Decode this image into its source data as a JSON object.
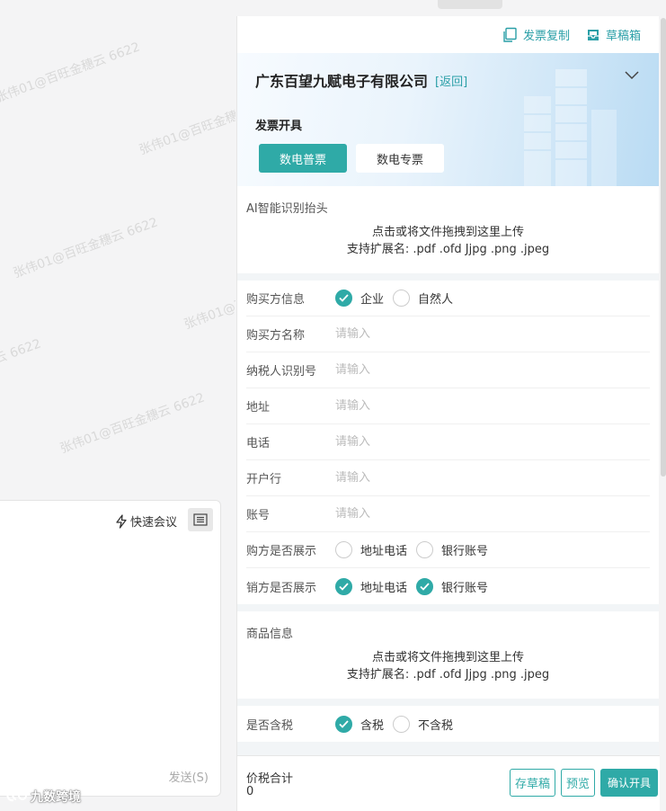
{
  "watermark": "张伟01@百旺金穗云 6622",
  "chat": {
    "quick_meeting": "快速会议",
    "send": "发送(S)",
    "brand": "九数跨境"
  },
  "toolbar": {
    "copy_invoice": "发票复制",
    "drafts": "草稿箱"
  },
  "header": {
    "company": "广东百望九赋电子有限公司",
    "back": "[返回]",
    "section_title": "发票开具",
    "tabs": [
      {
        "label": "数电普票",
        "active": true
      },
      {
        "label": "数电专票",
        "active": false
      }
    ]
  },
  "ai_upload": {
    "title": "AI智能识别抬头",
    "line1": "点击或将文件拖拽到这里上传",
    "line2": "支持扩展名: .pdf .ofd Jjpg .png .jpeg"
  },
  "buyer": {
    "type_label": "购买方信息",
    "type_options": [
      {
        "label": "企业",
        "checked": true
      },
      {
        "label": "自然人",
        "checked": false
      }
    ],
    "fields": [
      {
        "label": "购买方名称",
        "placeholder": "请输入"
      },
      {
        "label": "纳税人识别号",
        "placeholder": "请输入"
      },
      {
        "label": "地址",
        "placeholder": "请输入"
      },
      {
        "label": "电话",
        "placeholder": "请输入"
      },
      {
        "label": "开户行",
        "placeholder": "请输入"
      },
      {
        "label": "账号",
        "placeholder": "请输入"
      }
    ],
    "buyer_show": {
      "label": "购方是否展示",
      "options": [
        {
          "label": "地址电话",
          "checked": false
        },
        {
          "label": "银行账号",
          "checked": false
        }
      ]
    },
    "seller_show": {
      "label": "销方是否展示",
      "options": [
        {
          "label": "地址电话",
          "checked": true
        },
        {
          "label": "银行账号",
          "checked": true
        }
      ]
    }
  },
  "goods_upload": {
    "title": "商品信息",
    "line1": "点击或将文件拖拽到这里上传",
    "line2": "支持扩展名: .pdf .ofd Jjpg .png .jpeg"
  },
  "tax": {
    "label": "是否含税",
    "options": [
      {
        "label": "含税",
        "checked": true
      },
      {
        "label": "不含税",
        "checked": false
      }
    ]
  },
  "footer": {
    "total_label": "价税合计",
    "total_value": "0",
    "save_draft": "存草稿",
    "preview": "预览",
    "confirm": "确认开具"
  },
  "colors": {
    "accent": "#2faaa7",
    "link": "#2a9fa7"
  }
}
